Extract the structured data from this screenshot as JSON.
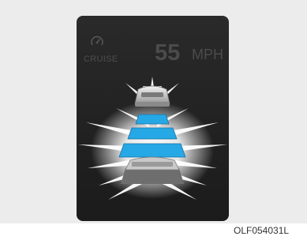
{
  "cluster": {
    "cruise_label": "CRUISE",
    "speed_value": "55",
    "speed_unit": "MPH",
    "set_speed_mph": 55,
    "distance_bars": 3,
    "icons": [
      "cruise-speedometer-icon",
      "lead-vehicle-icon",
      "own-vehicle-icon"
    ]
  },
  "figure": {
    "code": "OLF054031L"
  },
  "colors": {
    "background": "#ececec",
    "display": "#1f1f1f",
    "dim_text": "#4b4b4b",
    "bar_blue": "#26a8e6",
    "glow": "#ffffff"
  }
}
